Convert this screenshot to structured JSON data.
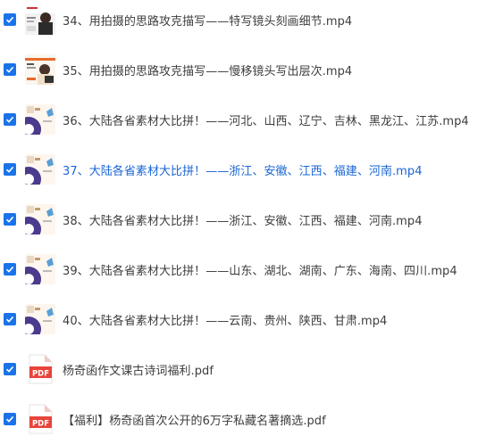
{
  "files": [
    {
      "name": "34、用拍摄的思路攻克描写——特写镜头刻画细节.mp4",
      "type": "video",
      "thumb": "lecture-dark",
      "checked": true,
      "highlighted": false
    },
    {
      "name": "35、用拍摄的思路攻克描写——慢移镜头写出层次.mp4",
      "type": "video",
      "thumb": "lecture-light",
      "checked": true,
      "highlighted": false
    },
    {
      "name": "36、大陆各省素材大比拼！——河北、山西、辽宁、吉林、黑龙江、江苏.mp4",
      "type": "video",
      "thumb": "map-purple",
      "checked": true,
      "highlighted": false
    },
    {
      "name": "37、大陆各省素材大比拼！——浙江、安徽、江西、福建、河南.mp4",
      "type": "video",
      "thumb": "map-purple",
      "checked": true,
      "highlighted": true
    },
    {
      "name": "38、大陆各省素材大比拼！——浙江、安徽、江西、福建、河南.mp4",
      "type": "video",
      "thumb": "map-purple",
      "checked": true,
      "highlighted": false
    },
    {
      "name": "39、大陆各省素材大比拼！——山东、湖北、湖南、广东、海南、四川.mp4",
      "type": "video",
      "thumb": "map-purple",
      "checked": true,
      "highlighted": false
    },
    {
      "name": "40、大陆各省素材大比拼！——云南、贵州、陕西、甘肃.mp4",
      "type": "video",
      "thumb": "map-purple",
      "checked": true,
      "highlighted": false
    },
    {
      "name": "杨奇函作文课古诗词福利.pdf",
      "type": "pdf",
      "thumb": "pdf-icon",
      "thumb_label": "PDF",
      "checked": true,
      "highlighted": false
    },
    {
      "name": "【福利】杨奇函首次公开的6万字私藏名著摘选.pdf",
      "type": "pdf",
      "thumb": "pdf-icon",
      "thumb_label": "PDF",
      "checked": true,
      "highlighted": false
    }
  ],
  "colors": {
    "checkbox": "#1a73e8",
    "text": "#3d3d3d",
    "highlight_text": "#1a66d6",
    "pdf_red": "#e8443a"
  }
}
